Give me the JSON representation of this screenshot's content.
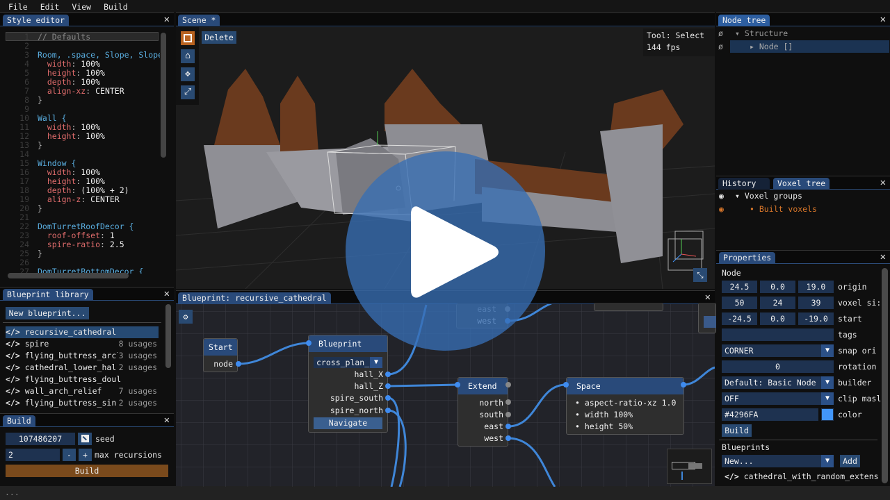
{
  "menu": [
    "File",
    "Edit",
    "View",
    "Build"
  ],
  "style_editor": {
    "title": "Style editor",
    "lines": [
      {
        "n": "1",
        "kind": "comment",
        "text": "// Defaults"
      },
      {
        "n": "2",
        "kind": "blank"
      },
      {
        "n": "3",
        "kind": "selector",
        "text": "Room, .space, Slope, Slope"
      },
      {
        "n": "4",
        "kind": "prop",
        "prop": "width",
        "value": "100%"
      },
      {
        "n": "5",
        "kind": "prop",
        "prop": "height",
        "value": "100%"
      },
      {
        "n": "6",
        "kind": "prop",
        "prop": "depth",
        "value": "100%"
      },
      {
        "n": "7",
        "kind": "prop",
        "prop": "align-xz",
        "value": "CENTER"
      },
      {
        "n": "8",
        "kind": "close",
        "text": "}"
      },
      {
        "n": "9",
        "kind": "blank"
      },
      {
        "n": "10",
        "kind": "selector",
        "text": "Wall {"
      },
      {
        "n": "11",
        "kind": "prop",
        "prop": "width",
        "value": "100%"
      },
      {
        "n": "12",
        "kind": "prop",
        "prop": "height",
        "value": "100%"
      },
      {
        "n": "13",
        "kind": "close",
        "text": "}"
      },
      {
        "n": "14",
        "kind": "blank"
      },
      {
        "n": "15",
        "kind": "selector",
        "text": "Window {"
      },
      {
        "n": "16",
        "kind": "prop",
        "prop": "width",
        "value": "100%"
      },
      {
        "n": "17",
        "kind": "prop",
        "prop": "height",
        "value": "100%"
      },
      {
        "n": "18",
        "kind": "prop",
        "prop": "depth",
        "value": "(100% + 2)"
      },
      {
        "n": "19",
        "kind": "prop",
        "prop": "align-z",
        "value": "CENTER"
      },
      {
        "n": "20",
        "kind": "close",
        "text": "}"
      },
      {
        "n": "21",
        "kind": "blank"
      },
      {
        "n": "22",
        "kind": "selector",
        "text": "DomTurretRoofDecor {"
      },
      {
        "n": "23",
        "kind": "prop",
        "prop": "roof-offset",
        "value": "1"
      },
      {
        "n": "24",
        "kind": "prop",
        "prop": "spire-ratio",
        "value": "2.5"
      },
      {
        "n": "25",
        "kind": "close",
        "text": "}"
      },
      {
        "n": "26",
        "kind": "blank"
      },
      {
        "n": "27",
        "kind": "selector",
        "text": "DomTurretBottomDecor {"
      }
    ]
  },
  "blueprint_library": {
    "title": "Blueprint library",
    "new_button": "New blueprint...",
    "items": [
      {
        "name": "recursive_cathedral",
        "usages": "",
        "selected": true
      },
      {
        "name": "spire",
        "usages": "8 usages"
      },
      {
        "name": "flying_buttress_arcl",
        "usages": "3 usages"
      },
      {
        "name": "cathedral_lower_hal",
        "usages": "2 usages"
      },
      {
        "name": "flying_buttress_doul",
        "usages": ""
      },
      {
        "name": "wall_arch_relief",
        "usages": "7 usages"
      },
      {
        "name": "flying_buttress_sin",
        "usages": "2 usages"
      }
    ]
  },
  "build": {
    "title": "Build",
    "seed": "107486207",
    "seed_label": "seed",
    "max_recursions": "2",
    "minus": "-",
    "plus": "+",
    "max_recursions_label": "max recursions",
    "build_button": "Build"
  },
  "status_bar": "...",
  "scene": {
    "title": "Scene *",
    "delete_button": "Delete",
    "tool_label": "Tool:  Select",
    "fps_label": "144  fps",
    "tools": [
      "select-frame",
      "home-add",
      "move",
      "scale"
    ]
  },
  "graph": {
    "title": "Blueprint: recursive_cathedral",
    "start": {
      "title": "Start",
      "pin": "node"
    },
    "blueprint": {
      "title": "Blueprint",
      "dropdown": "cross_plan_",
      "pins": [
        "hall_X",
        "hall_Z",
        "spire_south",
        "spire_north"
      ],
      "navigate": "Navigate"
    },
    "extend": {
      "title": "Extend",
      "pins": [
        "north",
        "south",
        "east",
        "west"
      ]
    },
    "space": {
      "title": "Space",
      "props": [
        "aspect-ratio-xz 1.0",
        "width 100%",
        "height 50%"
      ]
    },
    "partial_node": {
      "pins": [
        "east",
        "west"
      ]
    }
  },
  "node_tree": {
    "title": "Node tree",
    "items": [
      {
        "label": "Structure"
      },
      {
        "label": "Node []"
      }
    ]
  },
  "voxel_tree": {
    "tabs": [
      "History",
      "Voxel tree"
    ],
    "items": [
      {
        "label": "Voxel groups"
      },
      {
        "label": "Built voxels"
      }
    ]
  },
  "properties": {
    "title": "Properties",
    "section": "Node",
    "origin": [
      "24.5",
      "0.0",
      "19.0"
    ],
    "origin_label": "origin",
    "voxel_size": [
      "50",
      "24",
      "39"
    ],
    "voxel_size_label": "voxel si:",
    "start": [
      "-24.5",
      "0.0",
      "-19.0"
    ],
    "start_label": "start",
    "tags": "",
    "tags_label": "tags",
    "snap_origin": "CORNER",
    "snap_origin_label": "snap ori",
    "rotation": "0",
    "rotation_label": "rotation",
    "builder": "Default: Basic Node",
    "builder_label": "builder",
    "clip_mask": "OFF",
    "clip_mask_label": "clip masl",
    "color": "#4296FA",
    "color_label": "color",
    "build_button": "Build",
    "blueprints_label": "Blueprints",
    "blueprints_select": "New...",
    "add_button": "Add",
    "blueprint_item": "cathedral_with_random_extens"
  },
  "colors": {
    "accent": "#294a7a",
    "build": "#7a4a1c",
    "wire": "#3f86d8",
    "orange": "#d9772a",
    "swatch": "#4296FA"
  }
}
